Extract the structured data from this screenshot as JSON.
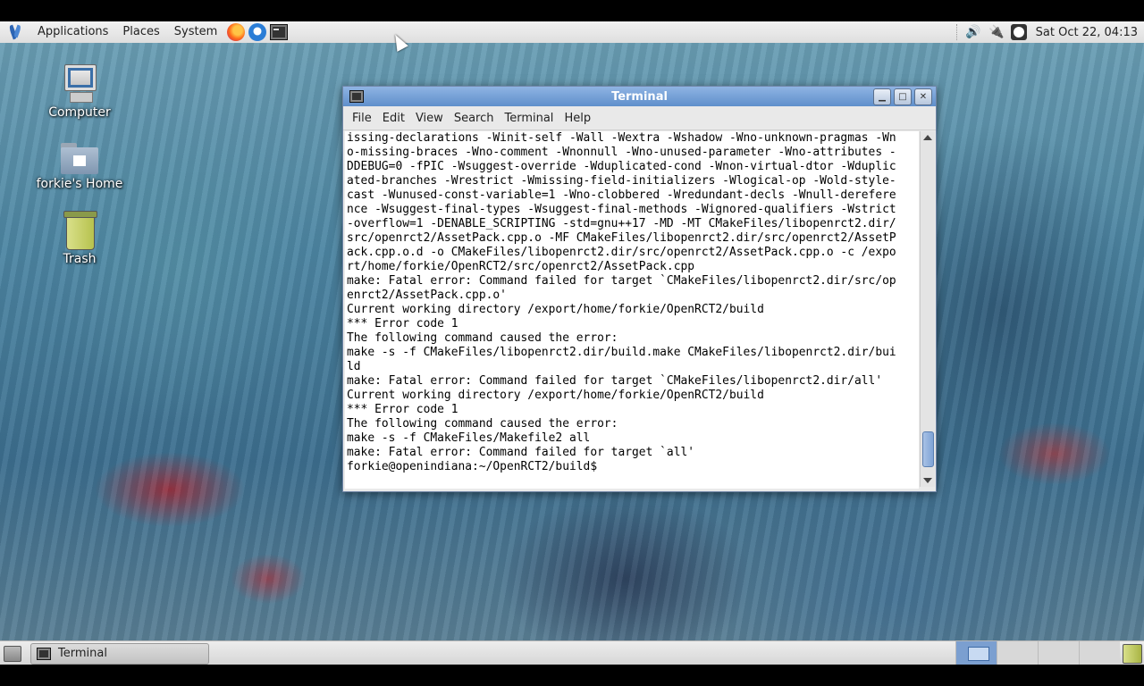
{
  "top_panel": {
    "menus": [
      "Applications",
      "Places",
      "System"
    ],
    "launchers": [
      "firefox-icon",
      "thunderbird-icon",
      "terminal-icon"
    ],
    "tray_icons": [
      "volume-icon",
      "network-icon",
      "clock-icon"
    ],
    "clock": "Sat Oct 22, 04:13"
  },
  "desktop_icons": {
    "computer": "Computer",
    "home": "forkie's Home",
    "trash": "Trash"
  },
  "terminal": {
    "title": "Terminal",
    "menu": [
      "File",
      "Edit",
      "View",
      "Search",
      "Terminal",
      "Help"
    ],
    "lines": [
      "issing-declarations -Winit-self -Wall -Wextra -Wshadow -Wno-unknown-pragmas -Wn",
      "o-missing-braces -Wno-comment -Wnonnull -Wno-unused-parameter -Wno-attributes -",
      "DDEBUG=0 -fPIC -Wsuggest-override -Wduplicated-cond -Wnon-virtual-dtor -Wduplic",
      "ated-branches -Wrestrict -Wmissing-field-initializers -Wlogical-op -Wold-style-",
      "cast -Wunused-const-variable=1 -Wno-clobbered -Wredundant-decls -Wnull-derefere",
      "nce -Wsuggest-final-types -Wsuggest-final-methods -Wignored-qualifiers -Wstrict",
      "-overflow=1 -DENABLE_SCRIPTING -std=gnu++17 -MD -MT CMakeFiles/libopenrct2.dir/",
      "src/openrct2/AssetPack.cpp.o -MF CMakeFiles/libopenrct2.dir/src/openrct2/AssetP",
      "ack.cpp.o.d -o CMakeFiles/libopenrct2.dir/src/openrct2/AssetPack.cpp.o -c /expo",
      "rt/home/forkie/OpenRCT2/src/openrct2/AssetPack.cpp",
      "make: Fatal error: Command failed for target `CMakeFiles/libopenrct2.dir/src/op",
      "enrct2/AssetPack.cpp.o'",
      "Current working directory /export/home/forkie/OpenRCT2/build",
      "*** Error code 1",
      "The following command caused the error:",
      "make -s -f CMakeFiles/libopenrct2.dir/build.make CMakeFiles/libopenrct2.dir/bui",
      "ld",
      "make: Fatal error: Command failed for target `CMakeFiles/libopenrct2.dir/all'",
      "Current working directory /export/home/forkie/OpenRCT2/build",
      "*** Error code 1",
      "The following command caused the error:",
      "make -s -f CMakeFiles/Makefile2 all",
      "make: Fatal error: Command failed for target `all'",
      "forkie@openindiana:~/OpenRCT2/build$ "
    ]
  },
  "bottom_panel": {
    "task_label": "Terminal",
    "workspaces": 4,
    "active_workspace": 1
  }
}
